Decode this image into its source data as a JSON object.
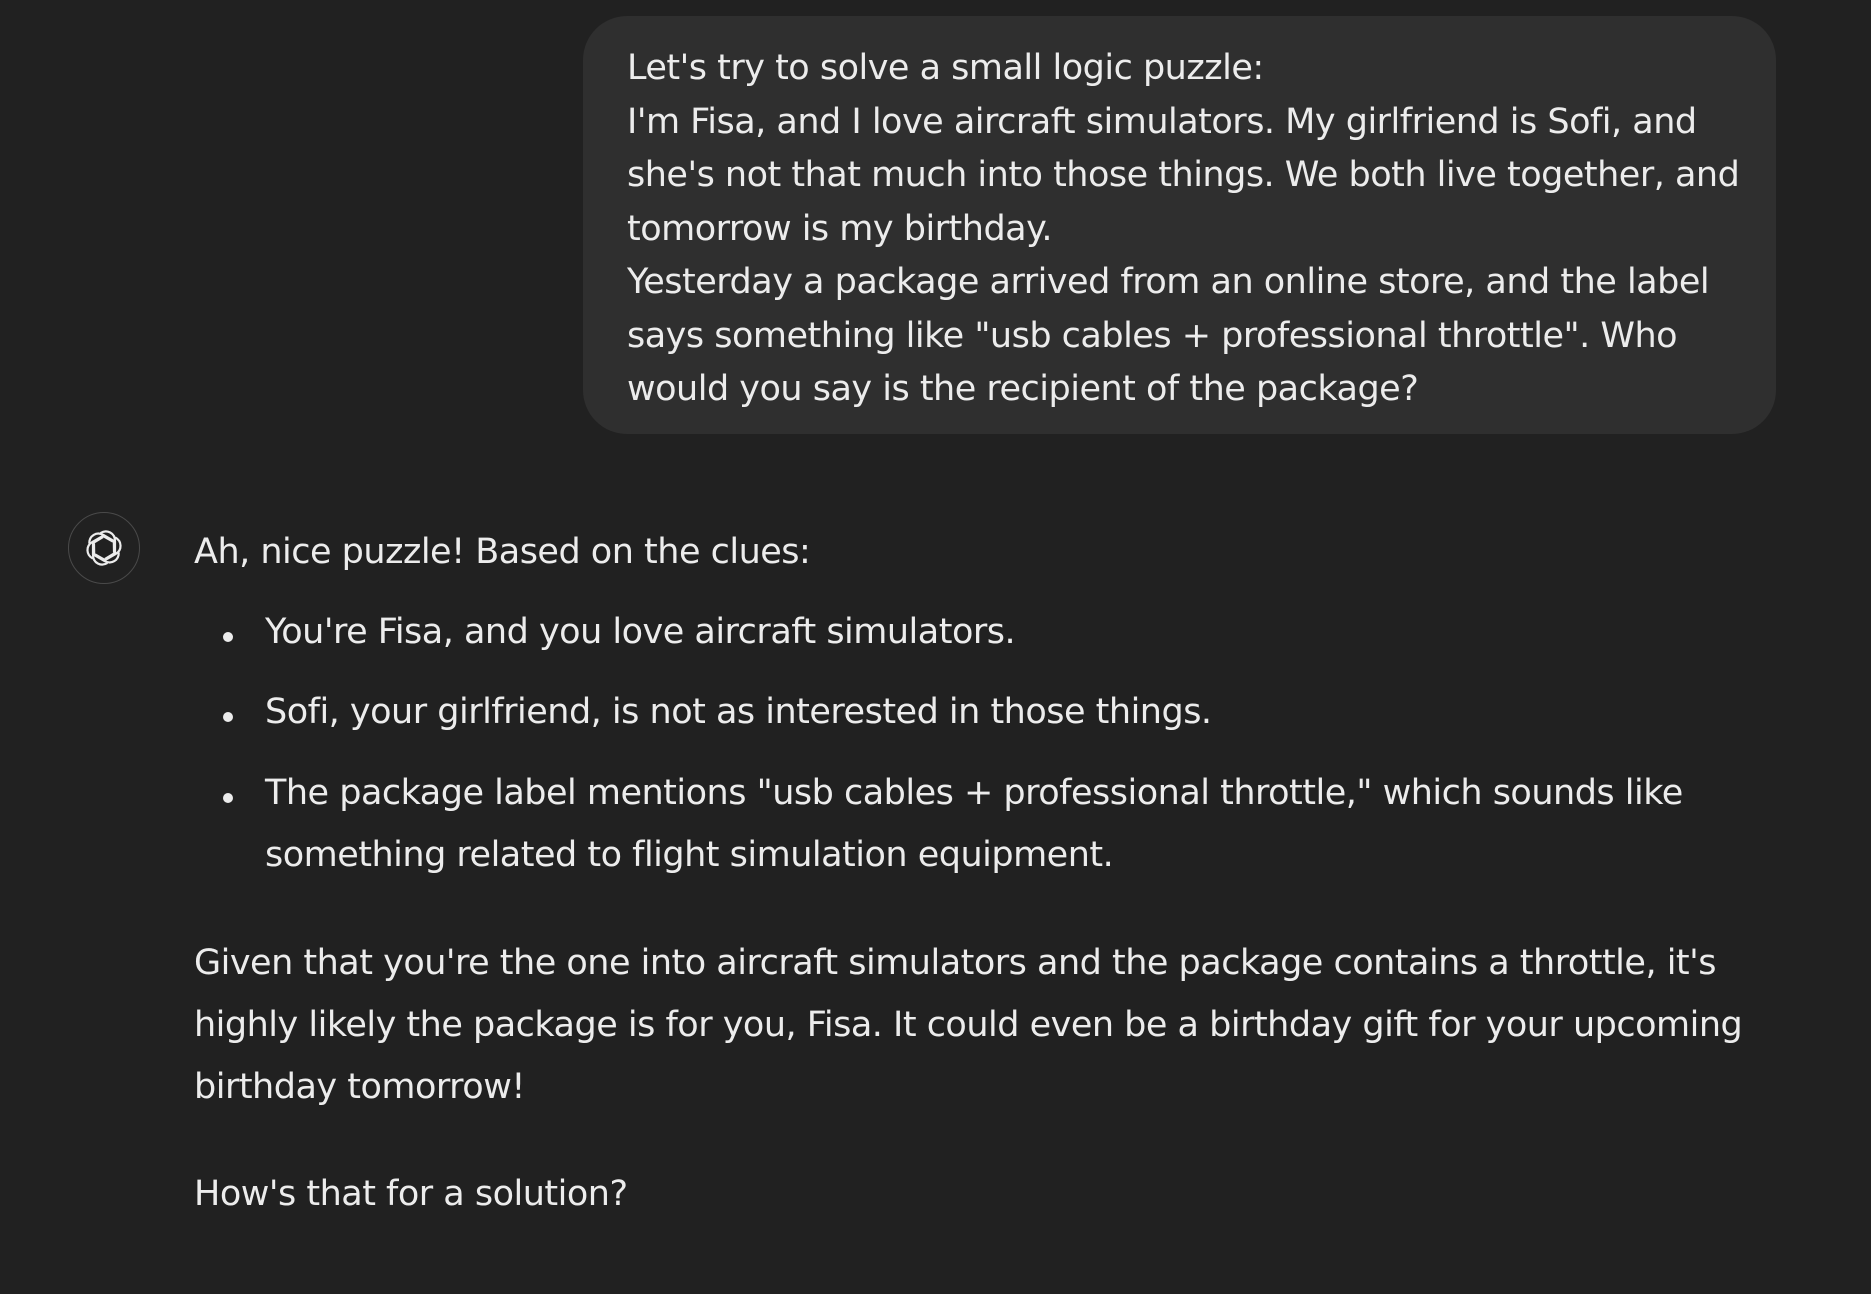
{
  "user_message": {
    "lines": [
      "Let's try to solve a small logic puzzle:",
      "I'm Fisa, and I love aircraft simulators. My girlfriend is Sofi, and",
      "she's not that much into those things. We both live together, and",
      "tomorrow is my birthday.",
      "Yesterday a package arrived from an online store, and the label",
      "says something like \"usb cables + professional throttle\". Who",
      "would you say is the recipient of the package?"
    ]
  },
  "assistant_message": {
    "avatar_icon": "openai-logo-icon",
    "intro": "Ah, nice puzzle! Based on the clues:",
    "bullets": [
      {
        "lines": [
          "You're Fisa, and you love aircraft simulators."
        ]
      },
      {
        "lines": [
          "Sofi, your girlfriend, is not as interested in those things."
        ]
      },
      {
        "lines": [
          "The package label mentions \"usb cables + professional throttle,\" which sounds like",
          "something related to flight simulation equipment."
        ]
      }
    ],
    "conclusion_lines": [
      "Given that you're the one into aircraft simulators and the package contains a throttle, it's",
      "highly likely the package is for you, Fisa. It could even be a birthday gift for your upcoming",
      "birthday tomorrow!"
    ],
    "closing": "How's that for a solution?"
  }
}
